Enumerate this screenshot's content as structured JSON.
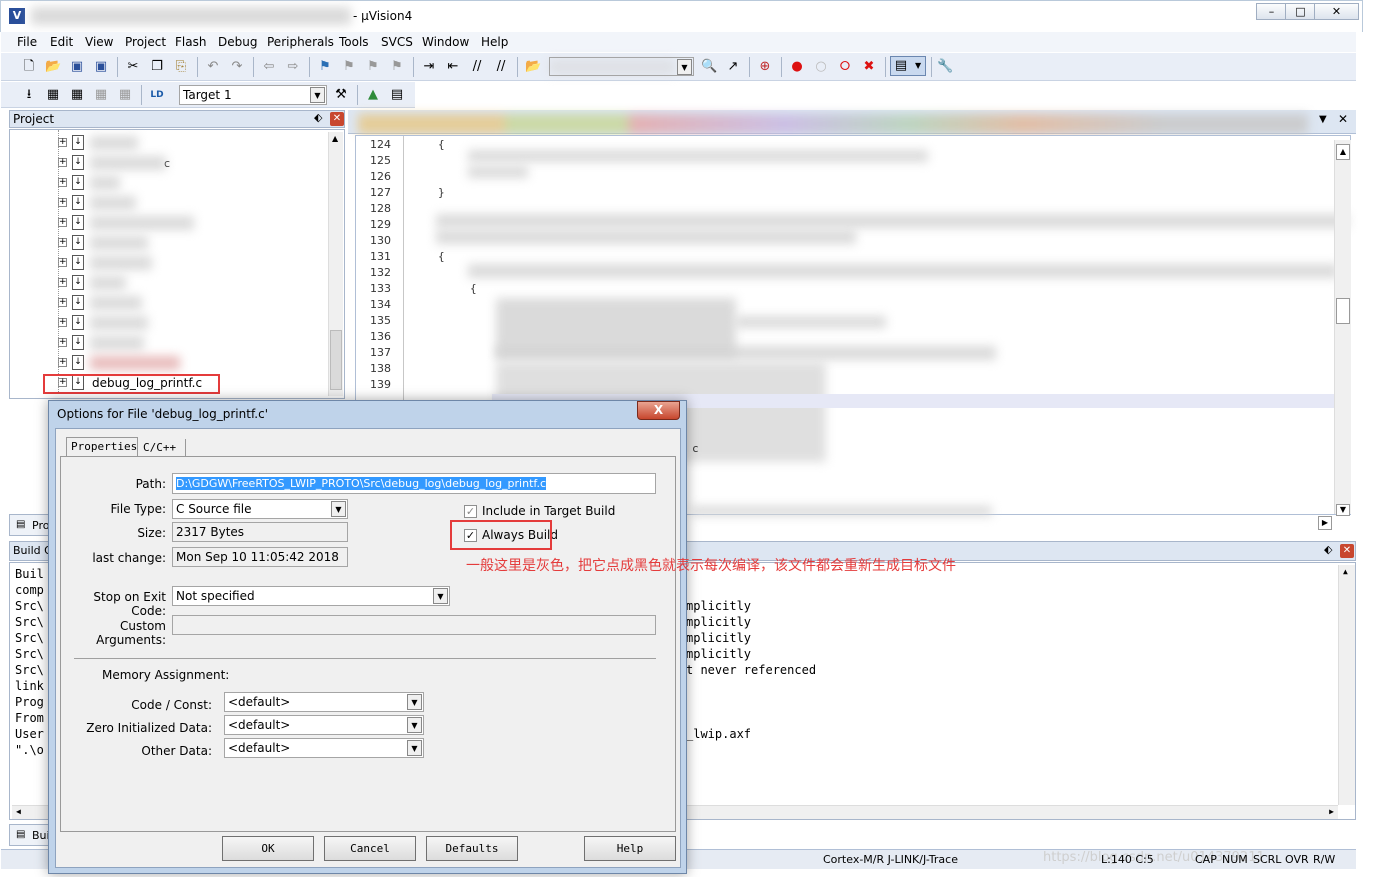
{
  "window": {
    "title": "- μVision4",
    "logo": "V"
  },
  "menu": [
    "File",
    "Edit",
    "View",
    "Project",
    "Flash",
    "Debug",
    "Peripherals",
    "Tools",
    "SVCS",
    "Window",
    "Help"
  ],
  "toolbar2": {
    "target": "Target 1"
  },
  "project_panel": {
    "title": "Project",
    "visible_file": "debug_log_printf.c",
    "partial_label": "c",
    "bottom_tab": "Pro"
  },
  "editor": {
    "line_numbers": [
      "124",
      "125",
      "126",
      "127",
      "128",
      "129",
      "130",
      "131",
      "132",
      "133",
      "134",
      "135",
      "136",
      "137",
      "138",
      "139"
    ],
    "brace_lines": {
      "l124": "{",
      "l127": "}",
      "l131": "{",
      "l133": "{"
    },
    "partial_text": "c"
  },
  "build_output": {
    "title": "Build O",
    "left_column": [
      "Buil",
      "comp",
      "Src\\",
      "Src\\",
      "Src\\",
      "Src\\",
      "Src\\",
      "link",
      "Prog",
      "From",
      "User",
      "\".\\o"
    ],
    "right_fragments": [
      "mplicitly",
      "mplicitly",
      "mplicitly",
      "mplicitly",
      "t never referenced",
      "_lwip.axf"
    ],
    "bottom_tab": "Bui"
  },
  "status_bar": {
    "debugger": "Cortex-M/R J-LINK/J-Trace",
    "position": "L:140 C:5",
    "indicators": [
      "CAP",
      "NUM",
      "SCRL",
      "OVR",
      "R/W"
    ],
    "watermark": "https://blog.csdn.net/u014379211"
  },
  "dialog": {
    "title": "Options for File 'debug_log_printf.c'",
    "close_label": "X",
    "tabs": [
      "Properties",
      "C/C++"
    ],
    "path_label": "Path:",
    "path_value": "D:\\GDGW\\FreeRTOS_LWIP_PROTO\\Src\\debug_log\\debug_log_printf.c",
    "file_type_label": "File Type:",
    "file_type_value": "C Source file",
    "size_label": "Size:",
    "size_value": "2317 Bytes",
    "last_change_label": "last change:",
    "last_change_value": "Mon Sep 10 11:05:42 2018",
    "include_label": "Include in Target Build",
    "include_checked": true,
    "always_build_label": "Always Build",
    "always_build_checked": true,
    "stop_on_exit_label": "Stop on Exit Code:",
    "stop_on_exit_value": "Not specified",
    "custom_args_label": "Custom Arguments:",
    "memory_title": "Memory Assignment:",
    "code_const_label": "Code / Const:",
    "zero_init_label": "Zero Initialized Data:",
    "other_data_label": "Other Data:",
    "default_value": "<default>",
    "buttons": {
      "ok": "OK",
      "cancel": "Cancel",
      "defaults": "Defaults",
      "help": "Help"
    }
  },
  "annotation": {
    "text": "一般这里是灰色，把它点成黑色就表示每次编译，该文件都会重新生成目标文件",
    "color": "#e43b3b"
  }
}
